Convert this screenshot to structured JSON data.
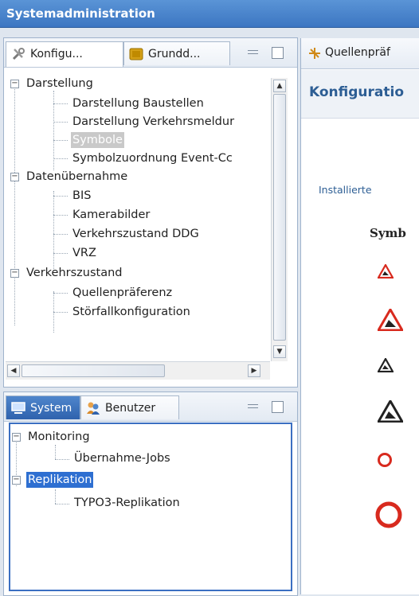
{
  "window": {
    "title": "Systemadministration"
  },
  "top_pane": {
    "tabs": [
      {
        "label": "Konfigu...",
        "icon": "tools-icon"
      },
      {
        "label": "Grundd...",
        "icon": "database-icon"
      }
    ],
    "tree": [
      {
        "label": "Darstellung",
        "children": [
          "Darstellung Baustellen",
          "Darstellung Verkehrsmeldur",
          "Symbole",
          "Symbolzuordnung Event-Cc"
        ]
      },
      {
        "label": "Datenübernahme",
        "children": [
          "BIS",
          "Kamerabilder",
          "Verkehrszustand DDG",
          "VRZ"
        ]
      },
      {
        "label": "Verkehrszustand",
        "children": [
          "Quellenpräferenz",
          "Störfallkonfiguration"
        ]
      }
    ],
    "selected_item": "Symbole"
  },
  "bottom_pane": {
    "tabs": [
      {
        "label": "System",
        "icon": "monitor-icon"
      },
      {
        "label": "Benutzer",
        "icon": "users-icon"
      }
    ],
    "tree": [
      {
        "label": "Monitoring",
        "children": [
          "Übernahme-Jobs"
        ]
      },
      {
        "label": "Replikation",
        "children": [
          "TYPO3-Replikation"
        ]
      }
    ],
    "selected_item": "Replikation"
  },
  "right_pane": {
    "tab_label": "Quellenpräf",
    "tab_icon": "source-icon",
    "header": "Konfiguratio",
    "installed_label": "Installierte",
    "symbol_col_header": "Symb",
    "symbols": [
      {
        "icon": "roadwork-sign-icon",
        "color": "#d82a1e",
        "size": "small"
      },
      {
        "icon": "roadwork-sign-icon",
        "color": "#d82a1e",
        "size": "large"
      },
      {
        "icon": "roadwork-sign-icon",
        "color": "#222222",
        "size": "small"
      },
      {
        "icon": "roadwork-sign-icon",
        "color": "#222222",
        "size": "large"
      },
      {
        "icon": "prohibition-circle-icon",
        "color": "#d82a1e",
        "size": "small"
      },
      {
        "icon": "prohibition-circle-icon",
        "color": "#d82a1e",
        "size": "large"
      }
    ]
  },
  "colors": {
    "title_bar": "#3c76c2",
    "selection_blue": "#2e6fd1",
    "selection_grey": "#c9c9c9",
    "header_text": "#2d5e94"
  }
}
